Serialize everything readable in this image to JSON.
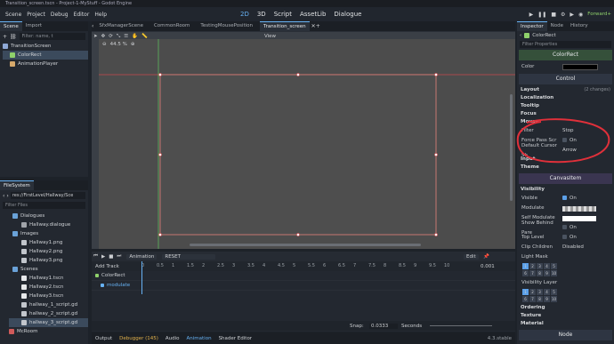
{
  "window": {
    "title": "Transition_screen.tscn - Project-1-MyStuff - Godot Engine"
  },
  "menu": [
    "Scene",
    "Project",
    "Debug",
    "Editor",
    "Help"
  ],
  "workspaces": [
    {
      "label": "2D",
      "active": true
    },
    {
      "label": "3D",
      "active": false
    },
    {
      "label": "Script",
      "active": false
    },
    {
      "label": "AssetLib",
      "active": false
    },
    {
      "label": "Dialogue",
      "active": false
    }
  ],
  "renderer": "Forward+",
  "scene_dock": {
    "tabs": [
      "Scene",
      "Import"
    ],
    "filter_placeholder": "Filter: name, t",
    "nodes": [
      {
        "label": "TransitionScreen",
        "selected": false
      },
      {
        "label": "ColorRect",
        "selected": true
      },
      {
        "label": "AnimationPlayer",
        "selected": false
      }
    ]
  },
  "filesystem": {
    "title": "FileSystem",
    "path": "res://FirstLevel/Hallway/Sce",
    "filter_placeholder": "Filter Files",
    "items": [
      {
        "label": "Dialogues",
        "type": "folder"
      },
      {
        "label": "Hallway.dialogue",
        "type": "file"
      },
      {
        "label": "Images",
        "type": "folder"
      },
      {
        "label": "Hallway1.png",
        "type": "image"
      },
      {
        "label": "Hallway2.png",
        "type": "image"
      },
      {
        "label": "Hallway3.png",
        "type": "image"
      },
      {
        "label": "Scenes",
        "type": "folder"
      },
      {
        "label": "Hallway1.tscn",
        "type": "scene"
      },
      {
        "label": "Hallway2.tscn",
        "type": "scene"
      },
      {
        "label": "Hallway3.tscn",
        "type": "scene"
      },
      {
        "label": "hallway_1_script.gd",
        "type": "script"
      },
      {
        "label": "hallway_2_script.gd",
        "type": "script"
      },
      {
        "label": "hallway_3_script.gd",
        "type": "script",
        "selected": true
      },
      {
        "label": "McRoom",
        "type": "folder"
      }
    ]
  },
  "scene_tabs": [
    "SfxManagerScene",
    "CommonRoom",
    "TestingMousePosition",
    "Transition_screen"
  ],
  "viewport": {
    "view_label": "View",
    "zoom": "44.5 %"
  },
  "animation": {
    "add_track": "Add Track",
    "anim_label": "Animation",
    "anim_name": "RESET",
    "edit": "Edit",
    "length": "0.001",
    "ruler": [
      "0",
      "0.5",
      "1",
      "1.5",
      "2",
      "2.5",
      "3",
      "3.5",
      "4",
      "4.5",
      "5",
      "5.5",
      "6",
      "6.5",
      "7",
      "7.5",
      "8",
      "8.5",
      "9",
      "9.5",
      "10"
    ],
    "tracks": [
      {
        "label": "ColorRect",
        "kind": "node"
      },
      {
        "label": "modulate",
        "kind": "property"
      }
    ],
    "snap_label": "Snap:",
    "snap_value": "0.0333",
    "snap_unit": "Seconds"
  },
  "bottom_tabs": [
    {
      "label": "Output",
      "active": false
    },
    {
      "label": "Debugger (145)",
      "active": false
    },
    {
      "label": "Audio",
      "active": false
    },
    {
      "label": "Animation",
      "active": true
    },
    {
      "label": "Shader Editor",
      "active": false
    }
  ],
  "version": "4.3.stable",
  "inspector": {
    "tabs": [
      "Inspector",
      "Node",
      "History"
    ],
    "node_name": "ColorRect",
    "filter_placeholder": "Filter Properties",
    "class_header": "ColorRect",
    "color_label": "Color",
    "control_header": "Control",
    "sections_control": [
      {
        "label": "Layout",
        "note": "(2 changes)"
      },
      {
        "label": "Localization",
        "note": ""
      },
      {
        "label": "Tooltip",
        "note": ""
      },
      {
        "label": "Focus",
        "note": ""
      },
      {
        "label": "Mouse",
        "note": ""
      }
    ],
    "mouse_props": [
      {
        "key": "Filter",
        "value": "Stop"
      },
      {
        "key": "Force Pass Scr",
        "value": "On"
      },
      {
        "key": "Default Cursor Sh",
        "value": "Arrow"
      }
    ],
    "sections_after_mouse": [
      "Input",
      "Theme"
    ],
    "canvasitem_header": "CanvasItem",
    "visibility_header": "Visibility",
    "visibility_props": [
      {
        "key": "Visible",
        "value": "On"
      },
      {
        "key": "Modulate",
        "value": ""
      },
      {
        "key": "Self Modulate",
        "value": ""
      },
      {
        "key": "Show Behind Pare",
        "value": "On"
      },
      {
        "key": "Top Level",
        "value": "On"
      },
      {
        "key": "Clip Children",
        "value": "Disabled"
      },
      {
        "key": "Light Mask",
        "value": ""
      }
    ],
    "light_mask_rows": [
      [
        "1",
        "2",
        "3",
        "4",
        "5"
      ],
      [
        "6",
        "7",
        "8",
        "9",
        "10"
      ]
    ],
    "visibility_layer": "Visibility Layer",
    "vis_layer_rows": [
      [
        "1",
        "2",
        "3",
        "4",
        "5"
      ],
      [
        "6",
        "7",
        "8",
        "9",
        "10"
      ]
    ],
    "sections_bottom": [
      "Ordering",
      "Texture",
      "Material"
    ],
    "node_footer": "Node"
  },
  "annotation_color": "#e0303a",
  "accent": "#67b2f4"
}
